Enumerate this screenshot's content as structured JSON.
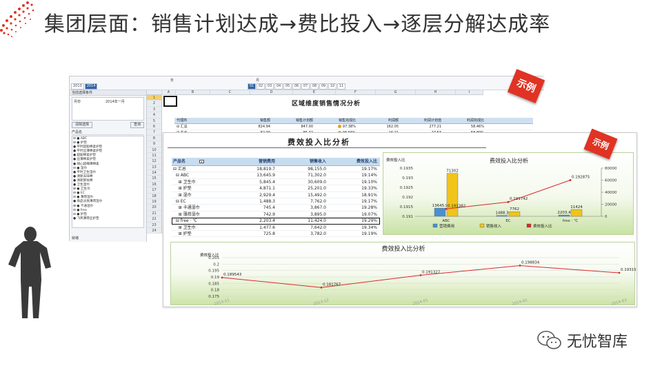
{
  "slide_title": "集团层面：销售计划达成→费比投入→逐层分解达成率",
  "brand": {
    "name": "无忧智库",
    "icon": "wechat-icon"
  },
  "stamp_text": "示例",
  "colors": {
    "accent_red": "#e03324",
    "grid_blue": "#2f62a8",
    "chart_green": "#c9e2a4"
  },
  "screenshot": {
    "date_filter": {
      "year_label": "年",
      "years": [
        "2013",
        "2014"
      ],
      "selected_year": "2014",
      "month_label": "月",
      "months": [
        "01",
        "02",
        "03",
        "04",
        "05",
        "06",
        "07",
        "08",
        "09",
        "10",
        "11"
      ],
      "selected_month": "01"
    },
    "filter_panel": {
      "header": "当前选择条件",
      "condition_label": "月份",
      "condition_value": "2014年一月",
      "clear_button": "清除选择",
      "query_button": "查询",
      "tree_header": "产品名",
      "tree_items": [
        "⊟ ● ABC",
        "  ⊟ ● 护垫",
        "    ● 平时超聪棉柔护垫",
        "    ● 平时丝薄棉柔护垫",
        "    ● 超聪棉柔护垫",
        "    ● 丝薄棉柔护垫",
        "    ● 随心超细薄棉柔",
        "  ⊟ ● 湿巾",
        "    ● 平时卫生湿巾",
        "    ● 清新去味棉",
        "    ● 清新卸妆棉",
        "    ● 卫生湿巾",
        "  ⊞ ● 卫生巾",
        "⊟ ● EC",
        "  ⊟ ● 薄荷湿巾",
        "    ● 商品淡爽薄荷湿巾",
        "  ⊞ ● 卡通湿巾",
        "⊟ ● free",
        "  ⊟ ● 护垫",
        "    ● 飞燕薄荷丝护垫"
      ],
      "status": "就绪"
    },
    "columns": [
      "A",
      "B",
      "C",
      "D",
      "E",
      "F",
      "G",
      "H",
      "I"
    ],
    "row_numbers": [
      "1",
      "2",
      "3",
      "4",
      "5",
      "6",
      "7",
      "8",
      "9",
      "10",
      "11",
      "12",
      "13",
      "14",
      "15",
      "16",
      "17",
      "18",
      "19",
      "20",
      "21",
      "22",
      "23",
      "24"
    ],
    "region_report": {
      "title": "区域维度销售情况分析",
      "headers": [
        "代理商",
        "销售额",
        "销售计划额",
        "销售完成比",
        "利润额",
        "利润计划值",
        "利润完成比"
      ],
      "rows": [
        [
          "⊟ 汇总",
          "824.94",
          "847.00",
          "97.38%",
          "162.05",
          "277.21",
          "58.46%"
        ],
        [
          "  ⊞ 东北",
          "82.39",
          "85.32",
          "96.56%",
          "16.21",
          "27.53",
          "58.89%"
        ]
      ],
      "status_colors": [
        "#e2a21e",
        "#e2a21e"
      ]
    }
  },
  "fee_report": {
    "title": "费效投入比分析",
    "headers": [
      "产品名",
      "营销费用",
      "销售收入",
      "费效投入比"
    ],
    "rows": [
      [
        "⊟ 汇总",
        "18,819.7",
        "98,155.0",
        "19.17%"
      ],
      [
        "  ⊟ ABC",
        "13,645.9",
        "71,302.0",
        "19.14%"
      ],
      [
        "    ⊞ 卫生巾",
        "5,845.4",
        "30,609.0",
        "19.10%"
      ],
      [
        "    ⊞ 护垫",
        "4,871.1",
        "25,201.0",
        "19.33%"
      ],
      [
        "    ⊞ 湿巾",
        "2,929.4",
        "15,492.0",
        "18.91%"
      ],
      [
        "  ⊟ EC",
        "1,488.3",
        "7,762.0",
        "19.17%"
      ],
      [
        "    ⊞ 卡通湿巾",
        "745.4",
        "3,867.0",
        "19.28%"
      ],
      [
        "    ⊞ 薄荷湿巾",
        "742.9",
        "3,895.0",
        "19.07%"
      ],
      [
        "  ⊟ free · ℃",
        "2,203.4",
        "11,424.0",
        "19.29%"
      ],
      [
        "    ⊞ 卫生巾",
        "1,477.6",
        "7,642.0",
        "19.34%"
      ],
      [
        "    ⊞ 护垫",
        "725.8",
        "3,782.0",
        "19.19%"
      ]
    ]
  },
  "chart_data": [
    {
      "type": "bar",
      "title": "费效投入比分析",
      "ylabel": "费效投入比",
      "categories": [
        "ABC",
        "EC",
        "free · ℃"
      ],
      "series": [
        {
          "name": "营销费用",
          "values": [
            13645.9,
            1488.3,
            2203.4
          ],
          "labels": [
            "13645.9",
            "1488.3",
            "2203.4"
          ],
          "color": "#4a8fd0",
          "axis": "right"
        },
        {
          "name": "销售收入",
          "values": [
            71302,
            7762,
            11424
          ],
          "labels": [
            "71302",
            "7762",
            "11424"
          ],
          "color": "#f0c419",
          "axis": "right"
        },
        {
          "name": "费效投入比",
          "values": [
            0.191382,
            0.191742,
            0.192875
          ],
          "labels": [
            "0.191382",
            "0.191742",
            "0.192875"
          ],
          "color": "#d62b2b",
          "axis": "left",
          "render": "line"
        }
      ],
      "y_left_ticks": [
        "0.191",
        "0.1915",
        "0.192",
        "0.1925",
        "0.193",
        "0.1935"
      ],
      "y_left_range": [
        0.191,
        0.1935
      ],
      "y_right_ticks": [
        "0",
        "20000",
        "40000",
        "60000",
        "80000"
      ],
      "y_right_range": [
        0,
        80000
      ],
      "legend": "bottom"
    },
    {
      "type": "line",
      "title": "费效投入比分析",
      "ylabel": "费效投入比",
      "x": [
        "2013-11",
        "2013-12",
        "2014-01",
        "2014-02",
        "2014-03"
      ],
      "series": [
        {
          "name": "费效投入比",
          "values": [
            0.189543,
            0.181767,
            0.191327,
            0.198834,
            0.193198
          ],
          "labels": [
            "0.189543",
            "0.181767",
            "0.191327",
            "0.198834",
            "0.193198"
          ],
          "color": "#d62b2b"
        }
      ],
      "y_ticks": [
        "0.175",
        "0.18",
        "0.185",
        "0.19",
        "0.195",
        "0.2",
        "0.205"
      ],
      "ylim": [
        0.175,
        0.205
      ],
      "grid": true
    }
  ]
}
